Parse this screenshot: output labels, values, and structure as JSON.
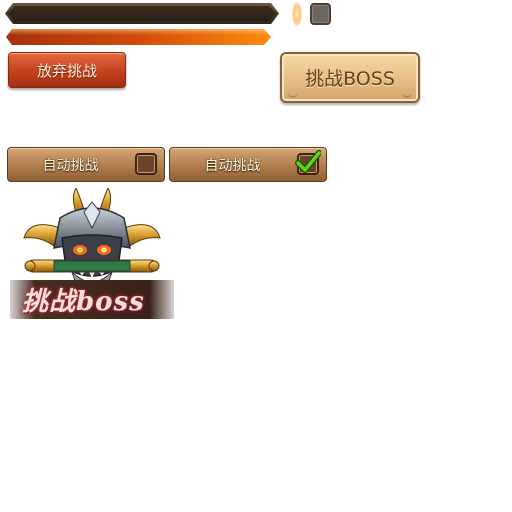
{
  "progress": {
    "empty_bar_fill": 0,
    "filled_bar_fill": 1.0
  },
  "buttons": {
    "give_up_label": "放弃挑战",
    "challenge_boss_label": "挑战BOSS"
  },
  "auto_challenge": [
    {
      "label": "自动挑战",
      "checked": false
    },
    {
      "label": "自动挑战",
      "checked": true
    }
  ],
  "emblem": {
    "title": "挑战boss",
    "icon": "demon-mask-icon"
  },
  "colors": {
    "accent_orange": "#ff8a0c",
    "button_red": "#c3421f",
    "button_tan": "#e6bf85",
    "check_green": "#5fd41a"
  }
}
